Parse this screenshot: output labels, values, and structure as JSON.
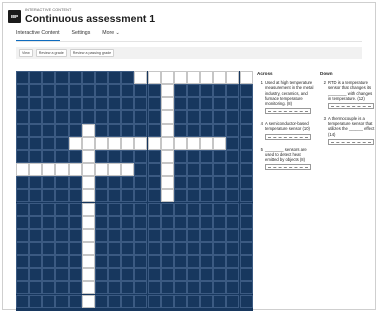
{
  "header": {
    "app_icon_text": "BIP",
    "kicker": "INTERACTIVE CONTENT",
    "title": "Continuous assessment 1"
  },
  "tabs": [
    {
      "label": "Interactive Content",
      "active": true
    },
    {
      "label": "Settings",
      "active": false
    },
    {
      "label": "More ⌄",
      "active": false
    }
  ],
  "subnav": {
    "chips": [
      "View",
      "Review a grade",
      "Review a passing grade"
    ]
  },
  "crossword": {
    "rows": 18,
    "cols": 18,
    "white_cells": [
      [
        0,
        9
      ],
      [
        0,
        10
      ],
      [
        0,
        11
      ],
      [
        0,
        12
      ],
      [
        0,
        13
      ],
      [
        0,
        14
      ],
      [
        0,
        15
      ],
      [
        0,
        16
      ],
      [
        0,
        17
      ],
      [
        1,
        11
      ],
      [
        2,
        11
      ],
      [
        3,
        11
      ],
      [
        4,
        11
      ],
      [
        5,
        11
      ],
      [
        6,
        11
      ],
      [
        7,
        11
      ],
      [
        8,
        11
      ],
      [
        9,
        11
      ],
      [
        4,
        5
      ],
      [
        5,
        5
      ],
      [
        5,
        4
      ],
      [
        5,
        6
      ],
      [
        5,
        7
      ],
      [
        5,
        8
      ],
      [
        5,
        9
      ],
      [
        5,
        10
      ],
      [
        5,
        12
      ],
      [
        5,
        13
      ],
      [
        5,
        14
      ],
      [
        5,
        15
      ],
      [
        6,
        5
      ],
      [
        7,
        5
      ],
      [
        8,
        5
      ],
      [
        9,
        5
      ],
      [
        10,
        5
      ],
      [
        11,
        5
      ],
      [
        12,
        5
      ],
      [
        13,
        5
      ],
      [
        14,
        5
      ],
      [
        15,
        5
      ],
      [
        16,
        5
      ],
      [
        17,
        5
      ],
      [
        7,
        0
      ],
      [
        7,
        1
      ],
      [
        7,
        2
      ],
      [
        7,
        3
      ],
      [
        7,
        4
      ],
      [
        7,
        6
      ],
      [
        7,
        7
      ],
      [
        7,
        8
      ]
    ]
  },
  "clues": {
    "across_heading": "Across",
    "down_heading": "Down",
    "across": [
      {
        "num": "1",
        "text": "Used at high temperature measurement in the metal industry, ceramics, and furnace temperature monitoring.  (8)"
      },
      {
        "num": "4",
        "text": "A semiconductor-based temperature sensor  (10)"
      },
      {
        "num": "5",
        "text": "________ sensors are used to detect heat emitted by objects  (8)"
      }
    ],
    "down": [
      {
        "num": "2",
        "text": "RTD is a temperature sensor that changes its ________ with changes in temperature.  (12)"
      },
      {
        "num": "3",
        "text": "A thermocouple is a temperature sensor that utilizes the ______ effect  (14)"
      }
    ]
  }
}
